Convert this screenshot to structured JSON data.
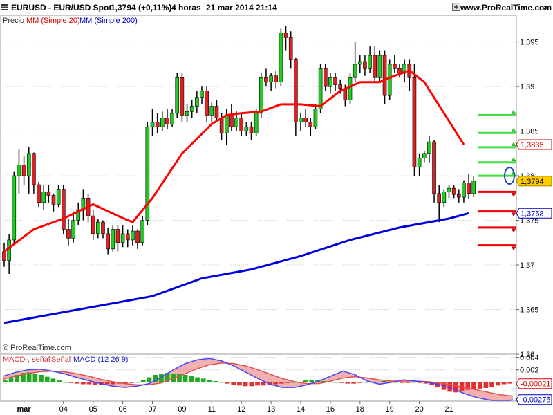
{
  "header": {
    "symbol": "EURUSD - EUR/USD Spot",
    "quote": "1,3794 (+0,11%)",
    "timeframe": "4 horas",
    "datetime": "21 mar 2014 21:14",
    "site": "www.ProRealTime.com",
    "close_symbol": "×"
  },
  "price_legend": {
    "label": "Precio",
    "ma_fast": "MM (Simple 20)",
    "ma_slow": "MM (Simple 200)"
  },
  "macd_legend": {
    "label1": "MACD-, señal",
    "label2": "Señal",
    "label3": "MACD (12 26 9)"
  },
  "copyright": "© ProRealTime.com",
  "colors": {
    "up": "#22cc22",
    "down": "#e02020",
    "ma_fast": "#ff0000",
    "ma_slow": "#0000dd",
    "macd_hist": "#22aa22",
    "signal_line": "#e05050",
    "macd_line": "#4444ff",
    "price_badge": "#ffcc00",
    "level_up": "#44dd44",
    "level_down": "#ee0000"
  },
  "icons": {
    "menu": "menu-icon",
    "tools": "tools-icon",
    "close": "close-icon"
  },
  "chart_data": [
    {
      "type": "candlestick",
      "title": "EURUSD - EUR/USD Spot",
      "ylim": [
        1.36,
        1.398
      ],
      "y_ticks": [
        {
          "value": 1.395,
          "label": "1,395"
        },
        {
          "value": 1.39,
          "label": "1,39"
        },
        {
          "value": 1.385,
          "label": "1,385"
        },
        {
          "value": 1.38,
          "label": "1,38"
        },
        {
          "value": 1.375,
          "label": "1,375"
        },
        {
          "value": 1.37,
          "label": "1,37"
        },
        {
          "value": 1.365,
          "label": "1,365"
        },
        {
          "value": 1.36,
          "label": "1,36"
        }
      ],
      "x_ticks": [
        {
          "index": 4,
          "label": "mar"
        },
        {
          "index": 12,
          "label": "04"
        },
        {
          "index": 18,
          "label": "05"
        },
        {
          "index": 24,
          "label": "06"
        },
        {
          "index": 30,
          "label": "07"
        },
        {
          "index": 36,
          "label": "09"
        },
        {
          "index": 42,
          "label": "11"
        },
        {
          "index": 48,
          "label": "12"
        },
        {
          "index": 54,
          "label": "13"
        },
        {
          "index": 60,
          "label": "14"
        },
        {
          "index": 66,
          "label": "16"
        },
        {
          "index": 72,
          "label": "18"
        },
        {
          "index": 78,
          "label": "19"
        },
        {
          "index": 84,
          "label": "20"
        },
        {
          "index": 90,
          "label": "21"
        }
      ],
      "candles": [
        [
          1.3715,
          1.3725,
          1.3698,
          1.3705
        ],
        [
          1.3705,
          1.3735,
          1.369,
          1.3728
        ],
        [
          1.3728,
          1.3805,
          1.3722,
          1.38
        ],
        [
          1.38,
          1.383,
          1.378,
          1.3812
        ],
        [
          1.3812,
          1.3822,
          1.379,
          1.38
        ],
        [
          1.38,
          1.3832,
          1.378,
          1.3825
        ],
        [
          1.3825,
          1.3826,
          1.378,
          1.379
        ],
        [
          1.379,
          1.3793,
          1.3765,
          1.377
        ],
        [
          1.377,
          1.379,
          1.3762,
          1.3782
        ],
        [
          1.3782,
          1.379,
          1.377,
          1.3778
        ],
        [
          1.3778,
          1.378,
          1.376,
          1.3768
        ],
        [
          1.3768,
          1.379,
          1.3765,
          1.3785
        ],
        [
          1.3785,
          1.379,
          1.3735,
          1.374
        ],
        [
          1.374,
          1.3752,
          1.3722,
          1.373
        ],
        [
          1.373,
          1.376,
          1.3725,
          1.375
        ],
        [
          1.375,
          1.377,
          1.3745,
          1.3762
        ],
        [
          1.3762,
          1.3785,
          1.375,
          1.3775
        ],
        [
          1.3775,
          1.378,
          1.3748,
          1.3755
        ],
        [
          1.3755,
          1.3762,
          1.3728,
          1.3735
        ],
        [
          1.3735,
          1.3752,
          1.373,
          1.3748
        ],
        [
          1.3748,
          1.375,
          1.373,
          1.3735
        ],
        [
          1.3735,
          1.3742,
          1.3712,
          1.3718
        ],
        [
          1.3718,
          1.3745,
          1.3715,
          1.374
        ],
        [
          1.374,
          1.3745,
          1.3715,
          1.3725
        ],
        [
          1.3725,
          1.3745,
          1.372,
          1.3735
        ],
        [
          1.3735,
          1.374,
          1.372,
          1.3728
        ],
        [
          1.3728,
          1.3745,
          1.3722,
          1.3738
        ],
        [
          1.3738,
          1.374,
          1.3718,
          1.3725
        ],
        [
          1.3725,
          1.3755,
          1.3722,
          1.375
        ],
        [
          1.375,
          1.386,
          1.3745,
          1.3855
        ],
        [
          1.3855,
          1.3875,
          1.3845,
          1.386
        ],
        [
          1.386,
          1.387,
          1.3848,
          1.3855
        ],
        [
          1.3855,
          1.3872,
          1.385,
          1.3865
        ],
        [
          1.3865,
          1.3875,
          1.3852,
          1.3858
        ],
        [
          1.3858,
          1.3875,
          1.3855,
          1.387
        ],
        [
          1.387,
          1.3915,
          1.3865,
          1.391
        ],
        [
          1.391,
          1.3915,
          1.386,
          1.3868
        ],
        [
          1.3868,
          1.388,
          1.386,
          1.3872
        ],
        [
          1.3872,
          1.3885,
          1.3865,
          1.3878
        ],
        [
          1.3878,
          1.3895,
          1.387,
          1.3888
        ],
        [
          1.3888,
          1.39,
          1.388,
          1.3895
        ],
        [
          1.3895,
          1.39,
          1.386,
          1.3868
        ],
        [
          1.3868,
          1.3882,
          1.386,
          1.3878
        ],
        [
          1.3878,
          1.3885,
          1.386,
          1.3865
        ],
        [
          1.3865,
          1.387,
          1.384,
          1.3848
        ],
        [
          1.3848,
          1.3875,
          1.3835,
          1.3868
        ],
        [
          1.3868,
          1.388,
          1.385,
          1.3855
        ],
        [
          1.3855,
          1.3872,
          1.385,
          1.3865
        ],
        [
          1.3865,
          1.387,
          1.3845,
          1.385
        ],
        [
          1.385,
          1.386,
          1.3845,
          1.3855
        ],
        [
          1.3855,
          1.386,
          1.384,
          1.3848
        ],
        [
          1.3848,
          1.3875,
          1.3845,
          1.387
        ],
        [
          1.387,
          1.3915,
          1.3865,
          1.391
        ],
        [
          1.391,
          1.392,
          1.39,
          1.3905
        ],
        [
          1.3905,
          1.3915,
          1.3895,
          1.3912
        ],
        [
          1.3912,
          1.3918,
          1.3898,
          1.3905
        ],
        [
          1.3905,
          1.3965,
          1.39,
          1.396
        ],
        [
          1.396,
          1.3968,
          1.394,
          1.3955
        ],
        [
          1.3955,
          1.3962,
          1.392,
          1.393
        ],
        [
          1.393,
          1.3932,
          1.3845,
          1.386
        ],
        [
          1.386,
          1.387,
          1.385,
          1.3865
        ],
        [
          1.3865,
          1.3875,
          1.3855,
          1.386
        ],
        [
          1.386,
          1.3865,
          1.3845,
          1.3855
        ],
        [
          1.3855,
          1.388,
          1.3852,
          1.3875
        ],
        [
          1.3875,
          1.3925,
          1.387,
          1.392
        ],
        [
          1.392,
          1.3925,
          1.3895,
          1.39
        ],
        [
          1.39,
          1.3915,
          1.3892,
          1.391
        ],
        [
          1.391,
          1.3915,
          1.3895,
          1.3902
        ],
        [
          1.3902,
          1.3908,
          1.3892,
          1.3898
        ],
        [
          1.3898,
          1.3902,
          1.3878,
          1.3885
        ],
        [
          1.3885,
          1.3915,
          1.388,
          1.391
        ],
        [
          1.391,
          1.395,
          1.3905,
          1.3925
        ],
        [
          1.3925,
          1.3935,
          1.3915,
          1.3928
        ],
        [
          1.3928,
          1.3935,
          1.3912,
          1.392
        ],
        [
          1.392,
          1.3945,
          1.3915,
          1.3935
        ],
        [
          1.3935,
          1.3945,
          1.3905,
          1.391
        ],
        [
          1.391,
          1.394,
          1.3905,
          1.3935
        ],
        [
          1.3935,
          1.394,
          1.388,
          1.389
        ],
        [
          1.389,
          1.393,
          1.3885,
          1.3925
        ],
        [
          1.3925,
          1.3935,
          1.3915,
          1.392
        ],
        [
          1.392,
          1.3925,
          1.391,
          1.3915
        ],
        [
          1.3915,
          1.393,
          1.3905,
          1.3925
        ],
        [
          1.3925,
          1.393,
          1.3895,
          1.391
        ],
        [
          1.391,
          1.3925,
          1.38,
          1.381
        ],
        [
          1.381,
          1.3825,
          1.38,
          1.382
        ],
        [
          1.382,
          1.3828,
          1.3815,
          1.3825
        ],
        [
          1.3825,
          1.3845,
          1.3815,
          1.3838
        ],
        [
          1.3838,
          1.384,
          1.377,
          1.378
        ],
        [
          1.378,
          1.379,
          1.3748,
          1.377
        ],
        [
          1.377,
          1.3785,
          1.3765,
          1.3782
        ],
        [
          1.3782,
          1.379,
          1.3775,
          1.3786
        ],
        [
          1.3786,
          1.379,
          1.3775,
          1.3779
        ],
        [
          1.3779,
          1.3785,
          1.377,
          1.3776
        ],
        [
          1.3776,
          1.3795,
          1.377,
          1.3792
        ],
        [
          1.3792,
          1.3802,
          1.3774,
          1.378
        ],
        [
          1.378,
          1.38,
          1.3776,
          1.3794
        ]
      ],
      "ma_fast_points": [
        [
          0,
          1.3715
        ],
        [
          6,
          1.374
        ],
        [
          12,
          1.3752
        ],
        [
          18,
          1.3768
        ],
        [
          23,
          1.3755
        ],
        [
          26,
          1.3748
        ],
        [
          30,
          1.3775
        ],
        [
          36,
          1.3825
        ],
        [
          42,
          1.3858
        ],
        [
          45,
          1.3868
        ],
        [
          48,
          1.387
        ],
        [
          52,
          1.3872
        ],
        [
          56,
          1.388
        ],
        [
          60,
          1.388
        ],
        [
          64,
          1.3878
        ],
        [
          68,
          1.3895
        ],
        [
          72,
          1.3905
        ],
        [
          76,
          1.3905
        ],
        [
          78,
          1.391
        ],
        [
          82,
          1.3918
        ],
        [
          85,
          1.3905
        ],
        [
          89,
          1.387
        ],
        [
          93,
          1.3835
        ]
      ],
      "ma_slow_points": [
        [
          0,
          1.3635
        ],
        [
          10,
          1.3645
        ],
        [
          20,
          1.3655
        ],
        [
          30,
          1.3665
        ],
        [
          40,
          1.3685
        ],
        [
          50,
          1.3695
        ],
        [
          60,
          1.371
        ],
        [
          70,
          1.3728
        ],
        [
          80,
          1.3742
        ],
        [
          90,
          1.3752
        ],
        [
          94,
          1.3758
        ]
      ],
      "badges": [
        {
          "value": 1.3835,
          "label": "1,3835",
          "style": "red"
        },
        {
          "value": 1.3794,
          "label": "1,3794",
          "style": "gold"
        },
        {
          "value": 1.3758,
          "label": "1,3758",
          "style": "blue"
        }
      ],
      "levels_up": [
        1.3868,
        1.3848,
        1.3832,
        1.3815,
        1.38
      ],
      "levels_down": [
        1.3782,
        1.376,
        1.3742,
        1.3722
      ]
    },
    {
      "type": "macd",
      "title": "MACD (12 26 9)",
      "ylim": [
        -0.003,
        0.0045
      ],
      "y_ticks": [
        {
          "value": 0.004,
          "label": "0,004"
        },
        {
          "value": 0.002,
          "label": "0,002"
        },
        {
          "value": 0,
          "label": "0"
        }
      ],
      "badges": [
        {
          "value": -0.00021,
          "label": "-0,00021",
          "style": "red"
        },
        {
          "value": -0.00275,
          "label": "-0,00275",
          "style": "blue"
        }
      ],
      "histogram": [
        0.0003,
        0.0008,
        0.0012,
        0.0015,
        0.0016,
        0.0014,
        0.0012,
        0.0009,
        0.0006,
        0.0003,
        0,
        -0.0001,
        -0.0002,
        -0.0003,
        -0.0003,
        -0.0004,
        -0.0004,
        -0.0003,
        -0.0003,
        -0.0002,
        -0.0002,
        -0.0001,
        0,
        0.0004,
        0.0008,
        0.0012,
        0.0014,
        0.0015,
        0.0014,
        0.0013,
        0.0012,
        0.001,
        0.0008,
        0.0006,
        0.0004,
        0.0002,
        0,
        -0.0002,
        -0.0004,
        -0.0005,
        -0.0006,
        -0.0006,
        -0.0005,
        -0.0005,
        -0.0004,
        -0.0003,
        -0.0002,
        -0.0001,
        0,
        0.0001,
        0.0003,
        0.0004,
        0.0003,
        0.0002,
        0.0001,
        0,
        -0.0001,
        -0.0002,
        -0.0002,
        -0.0001,
        0,
        0.0001,
        0.0001,
        0.0002,
        0.0001,
        0,
        -0.0001,
        -0.0001,
        0,
        -0.0001,
        -0.0002,
        -0.0004,
        -0.0008,
        -0.0012,
        -0.0015,
        -0.0016,
        -0.0014,
        -0.0012,
        -0.0011,
        -0.001,
        -0.0009,
        -0.0007,
        -0.0005,
        -0.0003,
        -0.0002
      ],
      "macd_line": [
        0.001,
        0.0016,
        0.002,
        0.0021,
        0.0018,
        0.0014,
        0.0008,
        0.0003,
        -0.0002,
        -0.0006,
        -0.0008,
        -0.0006,
        -0.0002,
        0.0008,
        0.002,
        0.003,
        0.0036,
        0.0038,
        0.0034,
        0.0026,
        0.0016,
        0.0006,
        -0.0003,
        -0.0008,
        -0.0008,
        -0.0004,
        0.0002,
        0.001,
        0.0018,
        0.0012,
        0.0002,
        -0.0003,
        0.0,
        0.0004,
        0.0002,
        0.0,
        -0.0004,
        -0.001,
        -0.0018,
        -0.0024,
        -0.0028,
        -0.003,
        -0.0028
      ],
      "signal_line": [
        0.0005,
        0.001,
        0.0014,
        0.0017,
        0.0018,
        0.0017,
        0.0014,
        0.001,
        0.0005,
        0.0001,
        -0.0002,
        -0.0004,
        -0.0004,
        -0.0001,
        0.0006,
        0.0014,
        0.0022,
        0.0028,
        0.0031,
        0.003,
        0.0026,
        0.002,
        0.0013,
        0.0006,
        0.0001,
        -0.0002,
        -0.0002,
        0.0002,
        0.0007,
        0.0009,
        0.0007,
        0.0004,
        0.0002,
        0.0002,
        0.0002,
        0.0001,
        -0.0001,
        -0.0004,
        -0.0008,
        -0.0012,
        -0.0016,
        -0.002,
        -0.0022
      ]
    }
  ]
}
